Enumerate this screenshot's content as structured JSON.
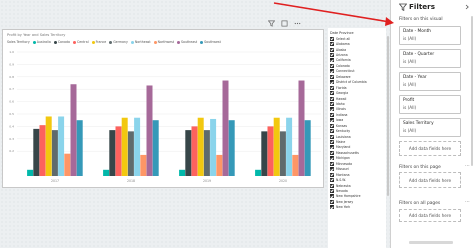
{
  "visual": {
    "title": "Profit by Year and Sales Territory",
    "legend_label": "Sales Territory",
    "legend_items": [
      {
        "name": "Australia",
        "color": "#01b8aa"
      },
      {
        "name": "Canada",
        "color": "#374649"
      },
      {
        "name": "Central",
        "color": "#fd625e"
      },
      {
        "name": "France",
        "color": "#f2c80f"
      },
      {
        "name": "Germany",
        "color": "#5f6b6d"
      },
      {
        "name": "Northeast",
        "color": "#8ad4eb"
      },
      {
        "name": "Northwest",
        "color": "#fe9666"
      },
      {
        "name": "Southeast",
        "color": "#a66999"
      },
      {
        "name": "Southwest",
        "color": "#3599b8"
      }
    ]
  },
  "chart_data": {
    "type": "bar",
    "title": "Profit by Year and Sales Territory",
    "categories": [
      "2017",
      "2018",
      "2019",
      "2020"
    ],
    "yticks": [
      "0.2",
      "0.3",
      "0.4",
      "0.5",
      "0.6",
      "0.7",
      "0.8",
      "0.9",
      "1.0"
    ],
    "ylim": [
      0,
      1.0
    ],
    "series": [
      {
        "name": "Australia",
        "color": "#01b8aa",
        "values": [
          0.05,
          0.05,
          0.05,
          0.05
        ]
      },
      {
        "name": "Canada",
        "color": "#374649",
        "values": [
          0.38,
          0.37,
          0.37,
          0.36
        ]
      },
      {
        "name": "Central",
        "color": "#fd625e",
        "values": [
          0.41,
          0.4,
          0.4,
          0.4
        ]
      },
      {
        "name": "France",
        "color": "#f2c80f",
        "values": [
          0.48,
          0.47,
          0.47,
          0.47
        ]
      },
      {
        "name": "Germany",
        "color": "#5f6b6d",
        "values": [
          0.37,
          0.36,
          0.37,
          0.36
        ]
      },
      {
        "name": "Northeast",
        "color": "#8ad4eb",
        "values": [
          0.48,
          0.47,
          0.46,
          0.47
        ]
      },
      {
        "name": "Northwest",
        "color": "#fe9666",
        "values": [
          0.18,
          0.17,
          0.17,
          0.17
        ]
      },
      {
        "name": "Southeast",
        "color": "#a66999",
        "values": [
          0.74,
          0.73,
          0.77,
          0.77
        ]
      },
      {
        "name": "Southwest",
        "color": "#3599b8",
        "values": [
          0.45,
          0.45,
          0.45,
          0.45
        ]
      }
    ]
  },
  "slicer": {
    "header": "Date Province",
    "items": [
      "Select all",
      "Alabama",
      "Alaska",
      "Arizona",
      "California",
      "Colorado",
      "Connecticut",
      "Delaware",
      "District of Columbia",
      "Florida",
      "Georgia",
      "Hawaii",
      "Idaho",
      "Illinois",
      "Indiana",
      "Iowa",
      "Kansas",
      "Kentucky",
      "Louisiana",
      "Maine",
      "Maryland",
      "Massachusetts",
      "Michigan",
      "Minnesota",
      "Missouri",
      "Montana",
      "N.S.W.",
      "Nebraska",
      "Nevada",
      "New Hampshire",
      "New Jersey",
      "New York"
    ]
  },
  "filters_pane": {
    "title": "Filters",
    "on_visual_label": "Filters on this visual",
    "on_page_label": "Filters on this page",
    "on_all_pages_label": "Filters on all pages",
    "add_field_label": "Add data fields here",
    "cards": [
      {
        "name": "Date - Month",
        "value": "is (All)"
      },
      {
        "name": "Date - Quarter",
        "value": "is (All)"
      },
      {
        "name": "Date - Year",
        "value": "is (All)"
      },
      {
        "name": "Profit",
        "value": "is (All)"
      },
      {
        "name": "Sales Territory",
        "value": "is (All)"
      }
    ],
    "more_icon": "ellipsis-icon"
  },
  "annotation": {
    "arrow_color": "#e02020"
  }
}
